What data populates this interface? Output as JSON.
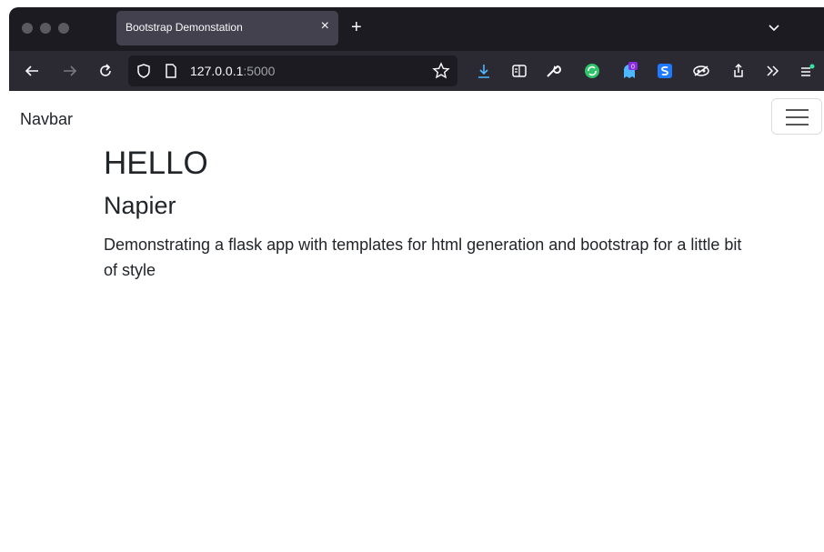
{
  "browser": {
    "tab": {
      "title": "Bootstrap Demonstation",
      "close": "×"
    },
    "new_tab": "+",
    "url": {
      "host": "127.0.0.1",
      "port": ":5000"
    },
    "extension_badge": "0"
  },
  "page": {
    "navbar": {
      "brand": "Navbar"
    },
    "heading": "HELLO",
    "subheading": "Napier",
    "lead": "Demonstrating a flask app with templates for html generation and bootstrap for a little bit of style"
  },
  "colors": {
    "tabstrip": "#1c1b22",
    "toolbar": "#2b2a33",
    "tab_active": "#42414d",
    "download_accent": "#4db8ff",
    "sync_green": "#30c36a",
    "s_extension_blue": "#1f7aff"
  }
}
